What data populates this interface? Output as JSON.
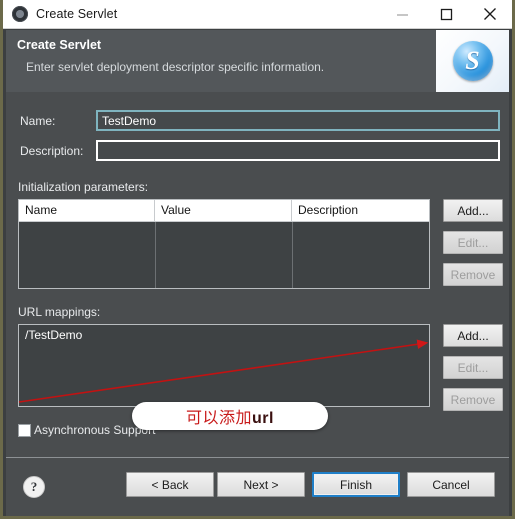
{
  "window": {
    "title": "Create Servlet",
    "icon": "servlet-gear-icon",
    "controls": {
      "minimize": "minimize-icon",
      "maximize": "maximize-icon",
      "close": "close-icon"
    }
  },
  "header": {
    "title": "Create Servlet",
    "subtitle": "Enter servlet deployment descriptor specific information.",
    "logo_letter": "S"
  },
  "form": {
    "name_label": "Name:",
    "name_value": "TestDemo",
    "name_placeholder": "",
    "description_label": "Description:",
    "description_value": "",
    "description_placeholder": ""
  },
  "init_params": {
    "section_label": "Initialization parameters:",
    "columns": [
      "Name",
      "Value",
      "Description"
    ],
    "rows": [],
    "buttons": [
      {
        "label": "Add...",
        "enabled": true
      },
      {
        "label": "Edit...",
        "enabled": false
      },
      {
        "label": "Remove",
        "enabled": false
      }
    ]
  },
  "url_mappings": {
    "section_label": "URL mappings:",
    "items": [
      "/TestDemo"
    ],
    "buttons": [
      {
        "label": "Add...",
        "enabled": true
      },
      {
        "label": "Edit...",
        "enabled": false
      },
      {
        "label": "Remove",
        "enabled": false
      }
    ]
  },
  "async": {
    "label": "Asynchronous Support",
    "checked": false
  },
  "footer": {
    "help": "?",
    "back": "< Back",
    "next": "Next >",
    "finish": "Finish",
    "cancel": "Cancel"
  },
  "annotation": {
    "callout_text_cn": "可以添加",
    "callout_text_en": "url",
    "arrow_color": "#d01818"
  },
  "colors": {
    "header_band": "#53575a",
    "dialog_body": "#4a4d4f",
    "accent_focus": "#1f7fc8",
    "field_focus": "#7fb4bf",
    "annotation_red": "#c81a1a"
  }
}
